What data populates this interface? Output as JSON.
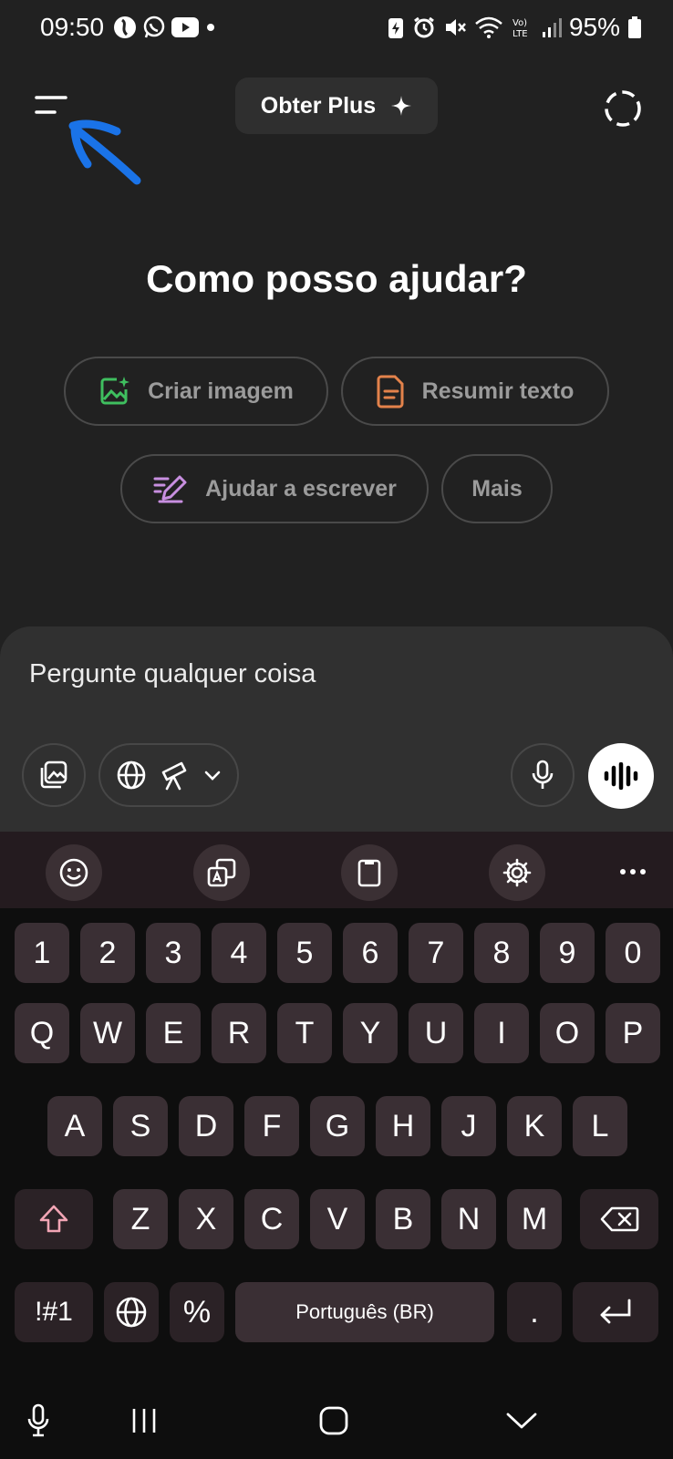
{
  "status_bar": {
    "time": "09:50",
    "battery": "95%",
    "network": "Vo) LTE"
  },
  "header": {
    "upgrade_label": "Obter Plus"
  },
  "main": {
    "headline": "Como posso ajudar?",
    "suggestions": [
      {
        "label": "Criar imagem",
        "icon": "image-sparkle-icon",
        "color": "#3fbf5f"
      },
      {
        "label": "Resumir texto",
        "icon": "document-icon",
        "color": "#e3824b"
      },
      {
        "label": "Ajudar a escrever",
        "icon": "pen-icon",
        "color": "#c88fe0"
      },
      {
        "label": "Mais",
        "icon": "",
        "color": ""
      }
    ]
  },
  "composer": {
    "placeholder": "Pergunte qualquer coisa"
  },
  "keyboard": {
    "row_numbers": [
      "1",
      "2",
      "3",
      "4",
      "5",
      "6",
      "7",
      "8",
      "9",
      "0"
    ],
    "row_top": [
      "Q",
      "W",
      "E",
      "R",
      "T",
      "Y",
      "U",
      "I",
      "O",
      "P"
    ],
    "row_middle": [
      "A",
      "S",
      "D",
      "F",
      "G",
      "H",
      "J",
      "K",
      "L"
    ],
    "row_bottom": [
      "Z",
      "X",
      "C",
      "V",
      "B",
      "N",
      "M"
    ],
    "symbols_label": "!#1",
    "percent_label": "%",
    "space_label": "Português (BR)",
    "period_label": "."
  },
  "colors": {
    "background": "#212121",
    "composer": "#303030",
    "annotation": "#1a73e8"
  }
}
